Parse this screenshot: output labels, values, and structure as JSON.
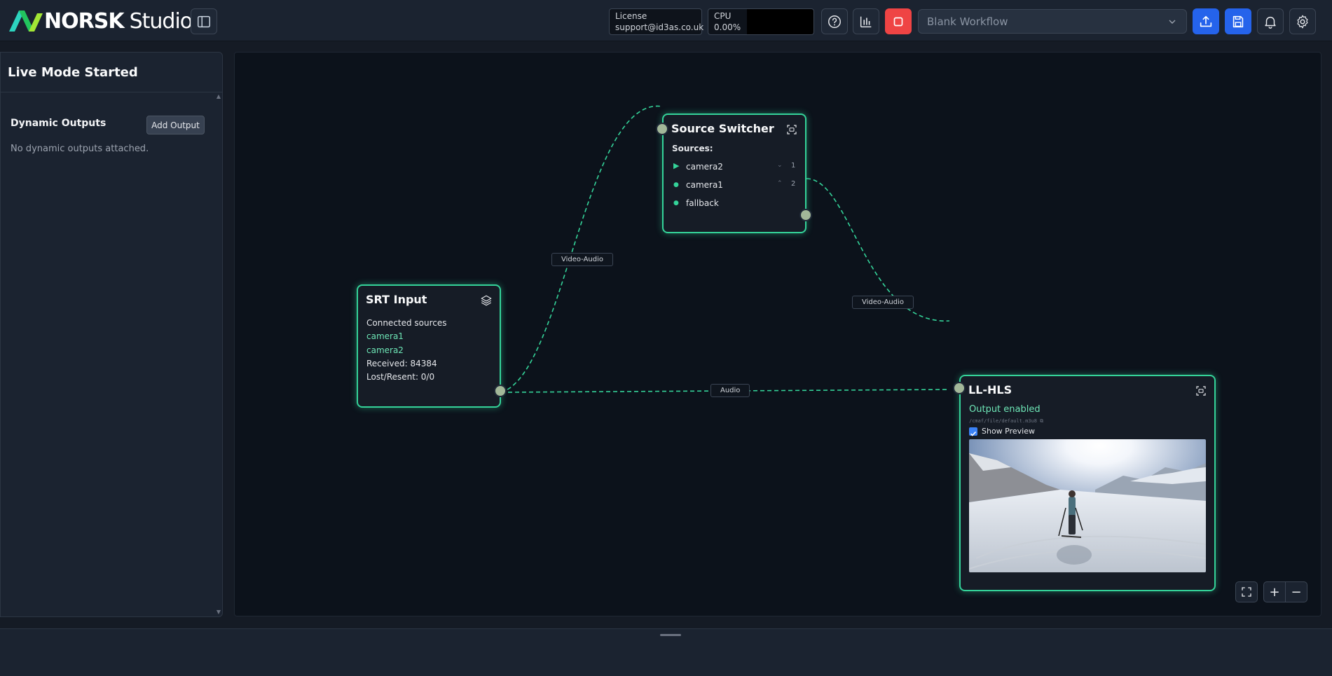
{
  "header": {
    "logo_brand": "NORSK",
    "logo_product": "Studio",
    "license_label": "License",
    "license_value": "support@id3as.co.uk",
    "cpu_label": "CPU",
    "cpu_value": "0.00%",
    "workflow_selected": "Blank Workflow",
    "icons": [
      "sidebar-toggle-icon",
      "help-icon",
      "stats-icon",
      "stop-icon",
      "upload-icon",
      "save-icon",
      "bell-icon",
      "gear-icon"
    ],
    "colors": {
      "stop": "#ef4444",
      "primary": "#2563eb"
    }
  },
  "sidebar": {
    "title": "Live Mode Started",
    "dynamic_outputs_label": "Dynamic Outputs",
    "add_output_label": "Add Output",
    "empty_message": "No dynamic outputs attached."
  },
  "canvas": {
    "accent": "#34d399",
    "edges": [
      {
        "label": "Video-Audio",
        "from": "SRT Input",
        "to": "Source Switcher"
      },
      {
        "label": "Video-Audio",
        "from": "Source Switcher",
        "to": "LL-HLS"
      },
      {
        "label": "Audio",
        "from": "SRT Input",
        "to": "LL-HLS"
      }
    ],
    "nodes": {
      "srt_input": {
        "title": "SRT Input",
        "connected_label": "Connected sources",
        "sources": [
          "camera1",
          "camera2"
        ],
        "received": "Received: 84384",
        "lost_resent": "Lost/Resent: 0/0"
      },
      "source_switcher": {
        "title": "Source Switcher",
        "sources_label": "Sources:",
        "sources": [
          {
            "name": "camera2",
            "arrow": "⌄",
            "num": "1",
            "active": true
          },
          {
            "name": "camera1",
            "arrow": "⌃",
            "num": "2",
            "active": false
          },
          {
            "name": "fallback",
            "arrow": "",
            "num": "",
            "active": false
          }
        ]
      },
      "ll_hls": {
        "title": "LL-HLS",
        "status": "Output enabled",
        "path": "/cmaf/file/default.m3u8",
        "show_preview_label": "Show Preview",
        "show_preview": true
      }
    },
    "controls": {
      "fullscreen_icon": "fullscreen-icon",
      "zoom_in": "+",
      "zoom_out": "−"
    }
  }
}
